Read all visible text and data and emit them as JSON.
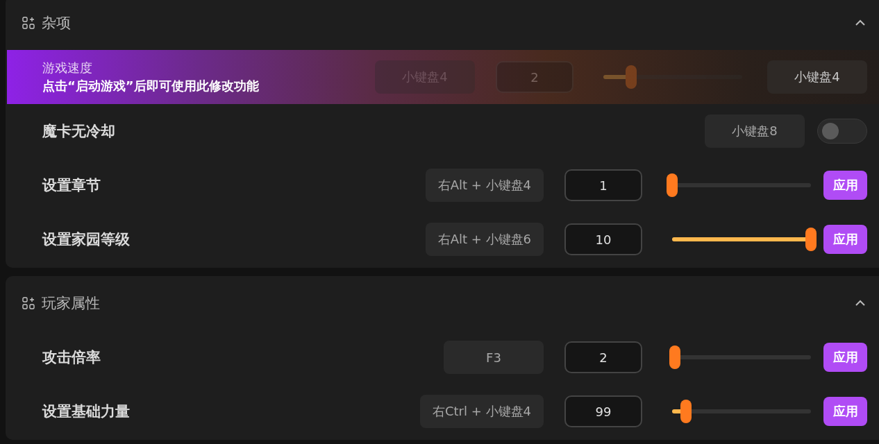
{
  "sections": [
    {
      "title": "杂项",
      "expanded": true,
      "rows": [
        {
          "kind": "slider",
          "label": "游戏速度",
          "disabled": true,
          "notice": "点击“启动游戏”后即可使用此修改功能",
          "hotkey": "小键盘4",
          "value": "2",
          "level": 0.2,
          "button": {
            "kind": "key",
            "label": "小键盘4"
          }
        },
        {
          "kind": "toggle",
          "label": "魔卡无冷却",
          "disabled": false,
          "hotkey": "小键盘8",
          "on": false
        },
        {
          "kind": "slider",
          "label": "设置章节",
          "disabled": false,
          "hotkey": "右Alt + 小键盘4",
          "value": "1",
          "level": 0,
          "button": {
            "kind": "apply",
            "label": "应用"
          }
        },
        {
          "kind": "slider",
          "label": "设置家园等级",
          "disabled": false,
          "hotkey": "右Alt + 小键盘6",
          "value": "10",
          "level": 1,
          "button": {
            "kind": "apply",
            "label": "应用"
          }
        }
      ]
    },
    {
      "title": "玩家属性",
      "expanded": true,
      "rows": [
        {
          "kind": "slider",
          "label": "攻击倍率",
          "disabled": false,
          "hotkey": "F3",
          "value": "2",
          "level": 0.02,
          "button": {
            "kind": "apply",
            "label": "应用"
          }
        },
        {
          "kind": "slider",
          "label": "设置基础力量",
          "disabled": false,
          "hotkey": "右Ctrl + 小键盘4",
          "value": "99",
          "level": 0.1,
          "button": {
            "kind": "apply",
            "label": "应用"
          }
        }
      ]
    }
  ]
}
